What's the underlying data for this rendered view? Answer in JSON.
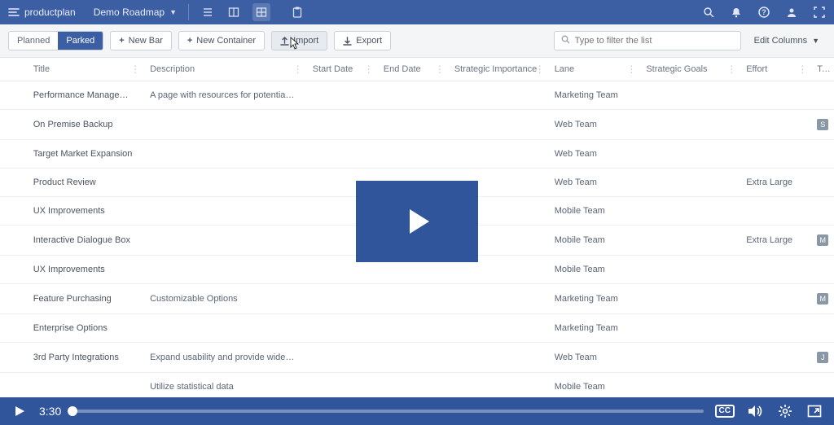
{
  "app": {
    "brand": "productplan",
    "roadmap_name": "Demo Roadmap"
  },
  "toolbar": {
    "tab_planned": "Planned",
    "tab_parked": "Parked",
    "new_bar": "New Bar",
    "new_container": "New Container",
    "import": "Import",
    "export": "Export",
    "filter_placeholder": "Type to filter the list",
    "edit_columns": "Edit Columns"
  },
  "columns": {
    "title": "Title",
    "description": "Description",
    "start_date": "Start Date",
    "end_date": "End Date",
    "strategic_importance": "Strategic Importance",
    "lane": "Lane",
    "strategic_goals": "Strategic Goals",
    "effort": "Effort",
    "tag": "Ta"
  },
  "rows": [
    {
      "title": "Performance Management",
      "description": "A page with resources for potential customers.",
      "lane": "Marketing Team",
      "effort": "",
      "tag": ""
    },
    {
      "title": "On Premise Backup",
      "description": "",
      "lane": "Web Team",
      "effort": "",
      "tag": "S"
    },
    {
      "title": "Target Market Expansion",
      "description": "",
      "lane": "Web Team",
      "effort": "",
      "tag": ""
    },
    {
      "title": "Product Review",
      "description": "",
      "lane": "Web Team",
      "effort": "Extra Large",
      "tag": ""
    },
    {
      "title": "UX Improvements",
      "description": "",
      "lane": "Mobile Team",
      "effort": "",
      "tag": ""
    },
    {
      "title": "Interactive Dialogue Box",
      "description": "",
      "lane": "Mobile Team",
      "effort": "Extra Large",
      "tag": "M"
    },
    {
      "title": "UX Improvements",
      "description": "",
      "lane": "Mobile Team",
      "effort": "",
      "tag": ""
    },
    {
      "title": "Feature Purchasing",
      "description": "Customizable Options",
      "lane": "Marketing Team",
      "effort": "",
      "tag": "M"
    },
    {
      "title": "Enterprise Options",
      "description": "",
      "lane": "Marketing Team",
      "effort": "",
      "tag": ""
    },
    {
      "title": "3rd Party Integrations",
      "description": "Expand usability and provide wider offering.",
      "lane": "Web Team",
      "effort": "",
      "tag": "J"
    },
    {
      "title": "",
      "description": "Utilize statistical data",
      "lane": "Mobile Team",
      "effort": "",
      "tag": ""
    }
  ],
  "video": {
    "time": "3:30",
    "cc": "CC"
  }
}
